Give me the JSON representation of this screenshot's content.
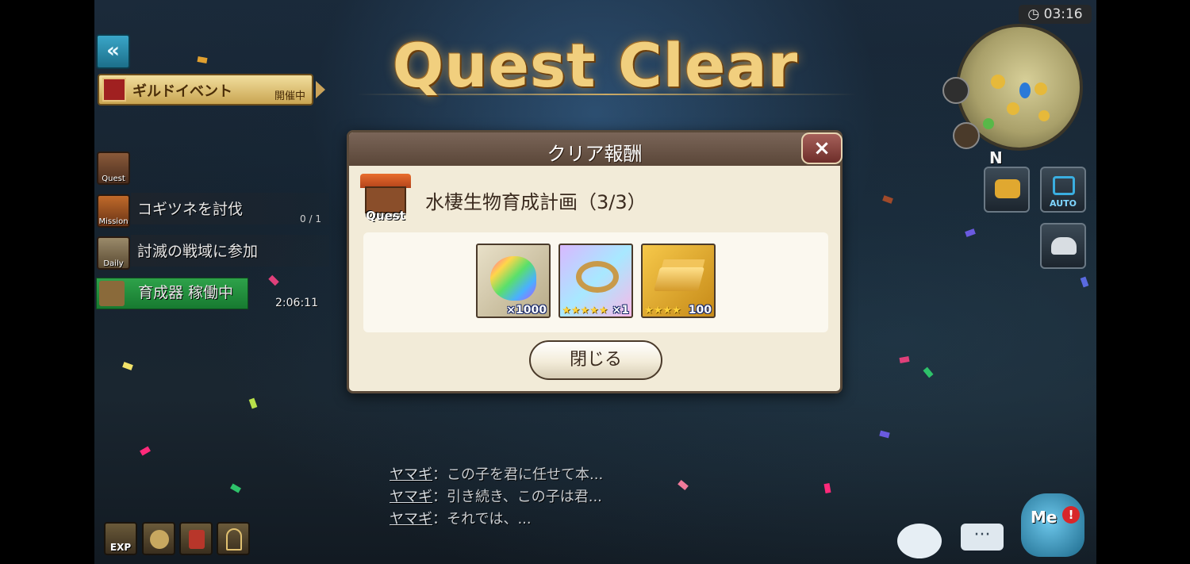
{
  "status_bar": {
    "clock": "03:16"
  },
  "title": "Quest Clear",
  "guild_event": {
    "label": "ギルドイベント",
    "status": "開催中"
  },
  "side_quests": [
    {
      "type": "Quest"
    },
    {
      "type": "Mission",
      "text": "コギツネを討伐",
      "count": "0 / 1"
    },
    {
      "type": "Daily",
      "text": "討滅の戦域に参加"
    },
    {
      "text": "育成器 稼働中",
      "timer": "2:06:11"
    }
  ],
  "minimap": {
    "compass": "N"
  },
  "hud": {
    "auto_label": "AUTO"
  },
  "dialog": {
    "title": "クリア報酬",
    "close_icon": "×",
    "quest_tag": "Quest",
    "quest_name": "水棲生物育成計画（3/3）",
    "rewards": [
      {
        "icon": "rainbow-dragon-crystal",
        "qty": "×1000"
      },
      {
        "icon": "gold-bracelet",
        "stars": "★★★★★",
        "qty": "×1"
      },
      {
        "icon": "gold-bars",
        "stars": "★★★★",
        "qty": "100"
      }
    ],
    "close_button": "閉じる"
  },
  "chat": [
    {
      "speaker": "ヤマギ",
      "text": "：この子を君に任せて本..."
    },
    {
      "speaker": "ヤマギ",
      "text": "：引き続き、この子は君..."
    },
    {
      "speaker": "ヤマギ",
      "text": "：それでは、..."
    }
  ],
  "bottom_bar": {
    "exp_label": "EXP",
    "me_label": "Me",
    "notify": "!"
  }
}
